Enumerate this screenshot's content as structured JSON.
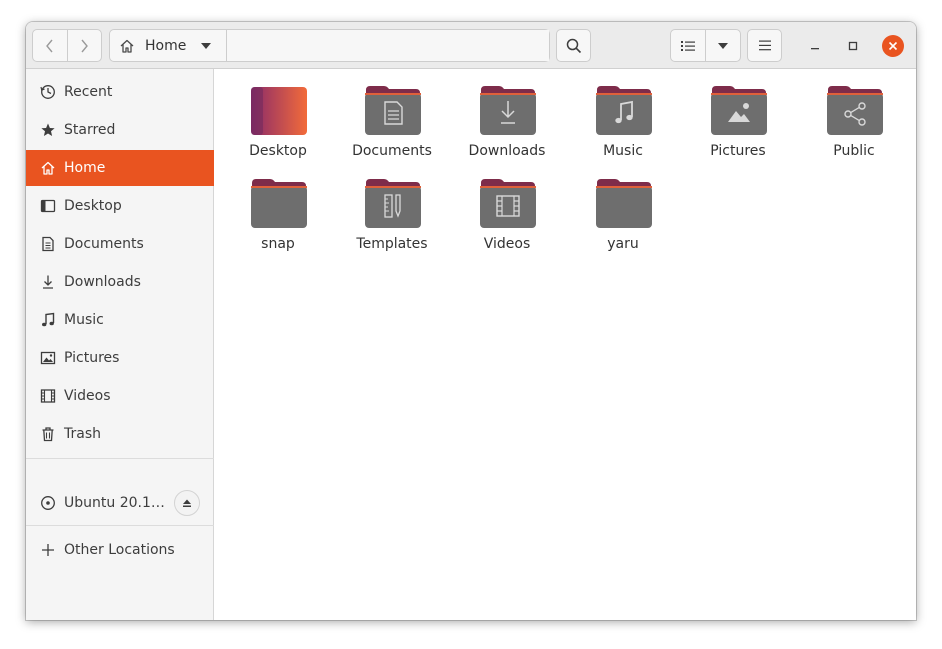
{
  "header": {
    "path_label": "Home",
    "icons": {
      "back": "chevron-left-icon",
      "forward": "chevron-right-icon",
      "home": "home-icon",
      "path_menu": "caret-down-icon",
      "search": "search-icon",
      "list_view": "list-view-icon",
      "view_options": "caret-down-icon",
      "main_menu": "hamburger-menu-icon",
      "minimize": "minimize-icon",
      "maximize": "maximize-icon",
      "close": "close-icon"
    }
  },
  "sidebar": {
    "items": [
      {
        "label": "Recent",
        "icon": "clock-icon"
      },
      {
        "label": "Starred",
        "icon": "star-icon"
      },
      {
        "label": "Home",
        "icon": "home-icon",
        "active": true
      },
      {
        "label": "Desktop",
        "icon": "desktop-icon"
      },
      {
        "label": "Documents",
        "icon": "document-icon"
      },
      {
        "label": "Downloads",
        "icon": "download-icon"
      },
      {
        "label": "Music",
        "icon": "music-icon"
      },
      {
        "label": "Pictures",
        "icon": "picture-icon"
      },
      {
        "label": "Videos",
        "icon": "video-icon"
      },
      {
        "label": "Trash",
        "icon": "trash-icon"
      }
    ],
    "device": {
      "label": "Ubuntu 20.1…",
      "icon": "disc-icon",
      "eject_icon": "eject-icon"
    },
    "other": {
      "label": "Other Locations",
      "icon": "plus-icon"
    }
  },
  "files": [
    {
      "name": "Desktop",
      "kind": "desktop"
    },
    {
      "name": "Documents",
      "kind": "documents"
    },
    {
      "name": "Downloads",
      "kind": "downloads"
    },
    {
      "name": "Music",
      "kind": "music"
    },
    {
      "name": "Pictures",
      "kind": "pictures"
    },
    {
      "name": "Public",
      "kind": "public"
    },
    {
      "name": "snap",
      "kind": "plain"
    },
    {
      "name": "Templates",
      "kind": "templates"
    },
    {
      "name": "Videos",
      "kind": "videos"
    },
    {
      "name": "yaru",
      "kind": "plain"
    }
  ],
  "colors": {
    "accent": "#e95420",
    "folder_body": "#6e6e6e",
    "folder_tab": "#7e2c4a"
  }
}
